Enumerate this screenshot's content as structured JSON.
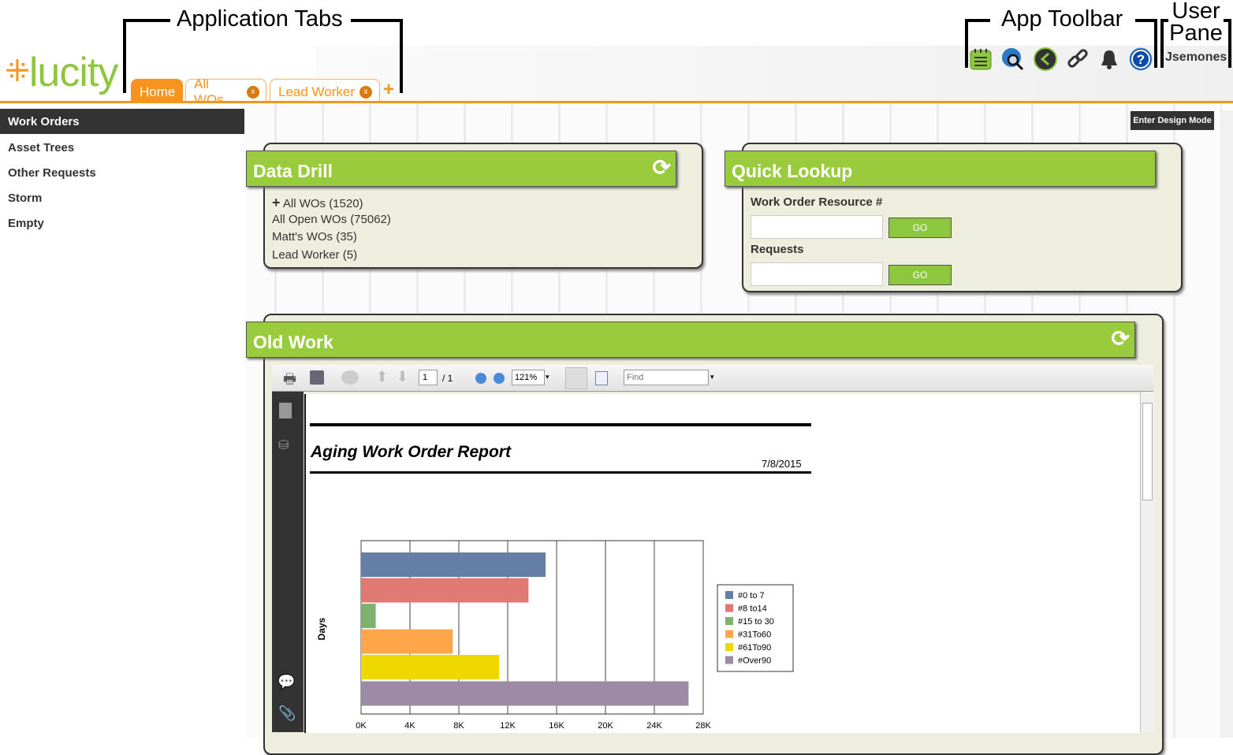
{
  "annotations": {
    "app_tabs": "Application Tabs",
    "app_toolbar": "App Toolbar",
    "user_pane_1": "User",
    "user_pane_2": "Pane"
  },
  "logo": "lucity",
  "tabs": [
    {
      "label": "Home",
      "active": true
    },
    {
      "label": "All WOs",
      "close": "x"
    },
    {
      "label": "Lead Worker",
      "close": "x"
    }
  ],
  "add_tab": "+",
  "toolbar": [
    "notepad-icon",
    "globe-search-icon",
    "dashboard-icon",
    "link-icon",
    "bell-icon",
    "help-icon"
  ],
  "user": "Jsemones",
  "design_mode": "Enter Design Mode",
  "sidebar": {
    "items": [
      {
        "label": "Work Orders",
        "active": true
      },
      {
        "label": "Asset Trees"
      },
      {
        "label": "Other Requests"
      },
      {
        "label": "Storm"
      },
      {
        "label": "Empty"
      }
    ]
  },
  "data_drill": {
    "title": "Data Drill",
    "links": [
      "All WOs (1520)",
      "All Open WOs (75062)",
      "Matt's WOs (35)",
      "Lead Worker (5)"
    ]
  },
  "quick_lookup": {
    "title": "Quick Lookup",
    "fields": [
      {
        "label": "Work Order Resource #",
        "value": "",
        "go": "GO"
      },
      {
        "label": "Requests",
        "value": "",
        "go": "GO"
      }
    ]
  },
  "old_work": {
    "title": "Old Work",
    "viewer": {
      "page": "1",
      "page_total": "/ 1",
      "zoom": "121%",
      "find_placeholder": "Find"
    },
    "report": {
      "title": "Aging Work Order Report",
      "date": "7/8/2015"
    }
  },
  "colors": {
    "accent_orange": "#f7941d",
    "panel_green": "#99cc3d"
  },
  "chart_data": {
    "type": "bar",
    "orientation": "horizontal",
    "ylabel": "Days",
    "xlim": [
      0,
      28000
    ],
    "ticks": [
      "0K",
      "4K",
      "8K",
      "12K",
      "16K",
      "20K",
      "24K",
      "28K"
    ],
    "grid": true,
    "legend": "right",
    "series": [
      {
        "name": "#0 to 7",
        "value": 15100,
        "color": "#647ea6"
      },
      {
        "name": "#8 to14",
        "value": 13700,
        "color": "#e07873"
      },
      {
        "name": "#15 to 30",
        "value": 1200,
        "color": "#7fb26f"
      },
      {
        "name": "#31To60",
        "value": 7500,
        "color": "#ffa54a"
      },
      {
        "name": "#61To90",
        "value": 11300,
        "color": "#eed800"
      },
      {
        "name": "#Over90",
        "value": 26800,
        "color": "#9d8ba5"
      }
    ]
  }
}
